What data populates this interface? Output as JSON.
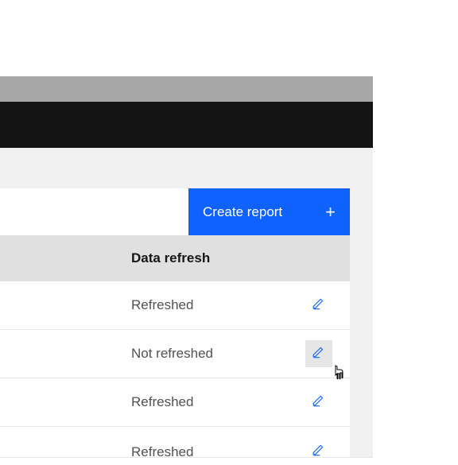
{
  "actions": {
    "create_report_label": "Create report"
  },
  "table": {
    "header": "Data refresh",
    "rows": [
      {
        "status": "Refreshed",
        "hovered": false
      },
      {
        "status": "Not refreshed",
        "hovered": true
      },
      {
        "status": "Refreshed",
        "hovered": false
      },
      {
        "status": "Refreshed",
        "hovered": false
      }
    ]
  }
}
